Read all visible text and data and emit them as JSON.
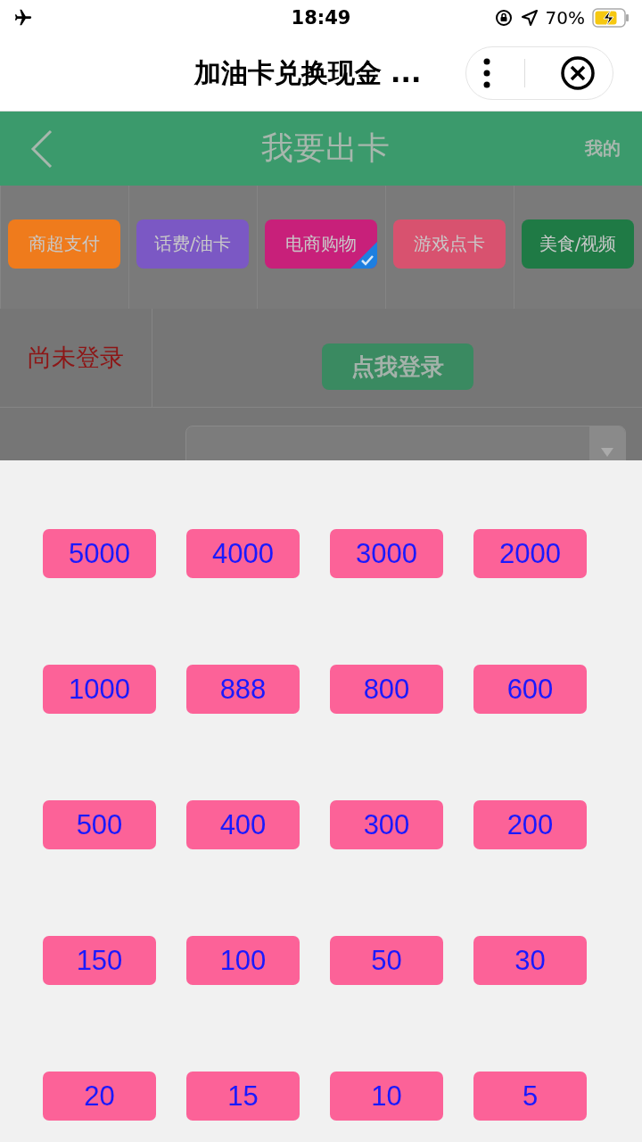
{
  "status_bar": {
    "time": "18:49",
    "battery": "70%"
  },
  "mini_nav": {
    "title": "加油卡兑换现金 ..."
  },
  "header": {
    "title": "我要出卡",
    "link": "我的"
  },
  "categories": [
    {
      "label": "商超支付",
      "color": "#ef7b1c",
      "selected": false
    },
    {
      "label": "话费/油卡",
      "color": "#7b58c4",
      "selected": false
    },
    {
      "label": "电商购物",
      "color": "#c8207a",
      "selected": true
    },
    {
      "label": "游戏点卡",
      "color": "#d8526f",
      "selected": false
    },
    {
      "label": "美食/视频",
      "color": "#1f7a45",
      "selected": false
    }
  ],
  "login": {
    "status": "尚未登录",
    "button": "点我登录"
  },
  "amounts": [
    "5000",
    "4000",
    "3000",
    "2000",
    "1000",
    "888",
    "800",
    "600",
    "500",
    "400",
    "300",
    "200",
    "150",
    "100",
    "50",
    "30",
    "20",
    "15",
    "10",
    "5"
  ]
}
